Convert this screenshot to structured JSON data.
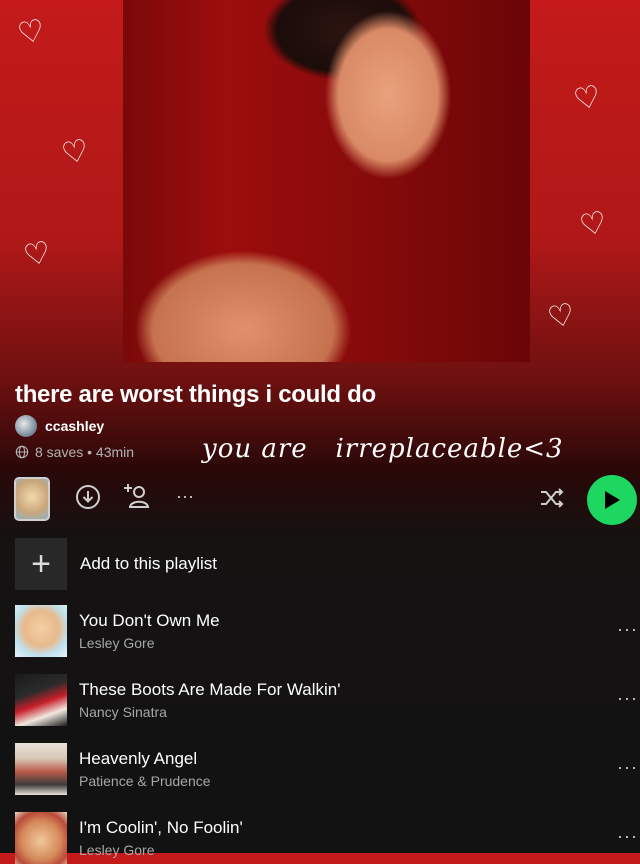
{
  "playlist": {
    "title": "there are worst things i could do",
    "owner": "ccashley",
    "meta": "8 saves • 43min",
    "caption": "you are   irreplaceable<3"
  },
  "doodles": [
    "♡",
    "♡",
    "♡",
    "♡",
    "♡",
    "♡",
    "♡"
  ],
  "icons": {
    "download": "download-icon",
    "add_user": "add-user-icon",
    "more": "more-icon",
    "shuffle": "shuffle-icon",
    "play": "play-icon",
    "globe": "globe-icon"
  },
  "colors": {
    "accent": "#1ed760",
    "bg_top": "#c41a1a",
    "bg_bottom": "#121212"
  },
  "add_label": "Add to this playlist",
  "more_glyph": "···",
  "tracks": [
    {
      "title": "You Don't Own Me",
      "artist": "Lesley Gore"
    },
    {
      "title": "These Boots Are Made For Walkin'",
      "artist": "Nancy Sinatra"
    },
    {
      "title": "Heavenly Angel",
      "artist": "Patience & Prudence"
    },
    {
      "title": "I'm Coolin', No Foolin'",
      "artist": "Lesley Gore"
    }
  ]
}
